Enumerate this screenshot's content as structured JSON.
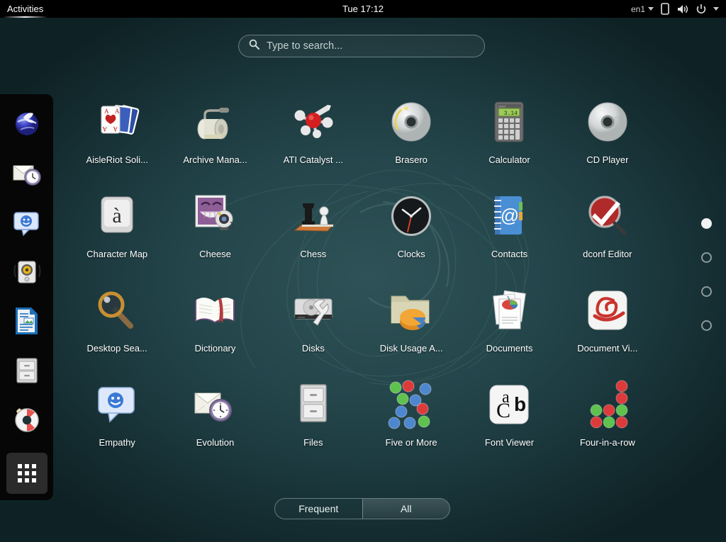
{
  "topbar": {
    "activities_label": "Activities",
    "clock": "Tue 17:12",
    "keyboard_layout": "en1",
    "icons": [
      "display-icon",
      "volume-icon",
      "power-icon",
      "chevron-down-icon"
    ]
  },
  "search": {
    "placeholder": "Type to search...",
    "value": "",
    "icon": "search-icon"
  },
  "dock": {
    "items": [
      {
        "name": "web-browser",
        "icon": "globe-icon"
      },
      {
        "name": "evolution-mail",
        "icon": "envelope-clock-icon"
      },
      {
        "name": "empathy-chat",
        "icon": "chat-smiley-icon"
      },
      {
        "name": "rhythmbox-music",
        "icon": "speaker-icon"
      },
      {
        "name": "libreoffice-writer",
        "icon": "document-blue-icon"
      },
      {
        "name": "files",
        "icon": "file-cabinet-icon"
      },
      {
        "name": "help",
        "icon": "lifebuoy-icon"
      },
      {
        "name": "show-applications",
        "icon": "grid-dots-icon",
        "selected": true
      }
    ]
  },
  "grid": {
    "apps": [
      {
        "label": "AisleRiot Soli...",
        "icon": "playing-cards-icon"
      },
      {
        "label": "Archive Mana...",
        "icon": "file-roller-icon"
      },
      {
        "label": "ATI Catalyst ...",
        "icon": "molecule-icon"
      },
      {
        "label": "Brasero",
        "icon": "cd-burn-icon"
      },
      {
        "label": "Calculator",
        "icon": "calculator-icon",
        "display": "3.14"
      },
      {
        "label": "CD Player",
        "icon": "cd-music-icon"
      },
      {
        "label": "Character Map",
        "icon": "keyboard-key-a-grave-icon"
      },
      {
        "label": "Cheese",
        "icon": "webcam-smiley-icon"
      },
      {
        "label": "Chess",
        "icon": "chess-pieces-icon"
      },
      {
        "label": "Clocks",
        "icon": "clock-face-icon"
      },
      {
        "label": "Contacts",
        "icon": "address-book-at-icon"
      },
      {
        "label": "dconf Editor",
        "icon": "checkmark-magnifier-icon"
      },
      {
        "label": "Desktop Sea...",
        "icon": "magnifier-icon"
      },
      {
        "label": "Dictionary",
        "icon": "open-book-icon"
      },
      {
        "label": "Disks",
        "icon": "harddisk-wrench-icon"
      },
      {
        "label": "Disk Usage A...",
        "icon": "folder-piechart-icon"
      },
      {
        "label": "Documents",
        "icon": "document-stack-icon"
      },
      {
        "label": "Document Vi...",
        "icon": "evince-icon"
      },
      {
        "label": "Empathy",
        "icon": "chat-smiley-icon"
      },
      {
        "label": "Evolution",
        "icon": "envelope-clock-icon"
      },
      {
        "label": "Files",
        "icon": "file-cabinet-icon"
      },
      {
        "label": "Five or More",
        "icon": "colored-balls-icon"
      },
      {
        "label": "Font Viewer",
        "icon": "abc-letters-icon",
        "display": "abC"
      },
      {
        "label": "Four-in-a-row",
        "icon": "four-in-a-row-discs-icon"
      }
    ]
  },
  "pages": {
    "count": 4,
    "current": 1
  },
  "view_selector": {
    "frequent_label": "Frequent",
    "all_label": "All",
    "active": "All"
  },
  "colors": {
    "topbar_bg": "#000000",
    "dock_bg": "#060606",
    "desktop_teal": "#24464b",
    "label_text": "#ffffff",
    "accent_white": "#f2f2f2"
  }
}
